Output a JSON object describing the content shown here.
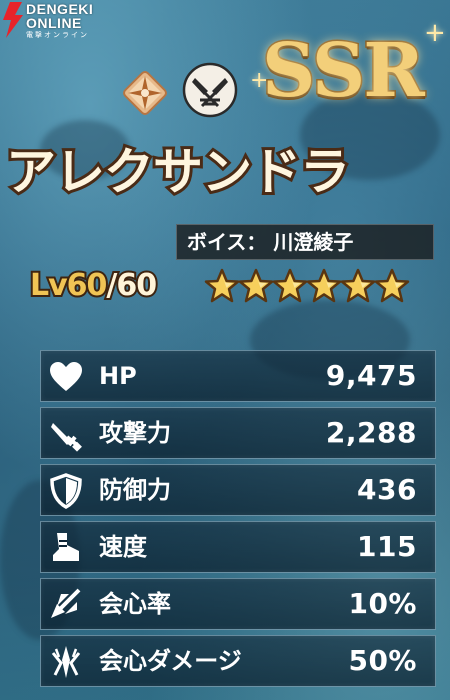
{
  "brand": {
    "line1": "DENGEKI",
    "line2": "ONLINE",
    "sub": "電撃オンライン"
  },
  "header": {
    "element_icon": "compass-star-icon",
    "weapon_icon": "crossed-swords-icon",
    "rarity": "SSR"
  },
  "character": {
    "name": "アレクサンドラ",
    "voice": "ボイス： 川澄綾子",
    "level_label": "Lv60",
    "level_max": "/60",
    "stars": 6
  },
  "stats": [
    {
      "icon": "heart-icon",
      "label": "HP",
      "value": "9,475"
    },
    {
      "icon": "sword-icon",
      "label": "攻撃力",
      "value": "2,288"
    },
    {
      "icon": "shield-icon",
      "label": "防御力",
      "value": "436"
    },
    {
      "icon": "boot-icon",
      "label": "速度",
      "value": "115"
    },
    {
      "icon": "crit-arrow-icon",
      "label": "会心率",
      "value": "10%"
    },
    {
      "icon": "crit-burst-icon",
      "label": "会心ダメージ",
      "value": "50%"
    }
  ],
  "colors": {
    "gold": "#f0c455",
    "ssr_gold": "#f3cf7a",
    "panel": "#10263a",
    "logo_red": "#e8232a"
  }
}
